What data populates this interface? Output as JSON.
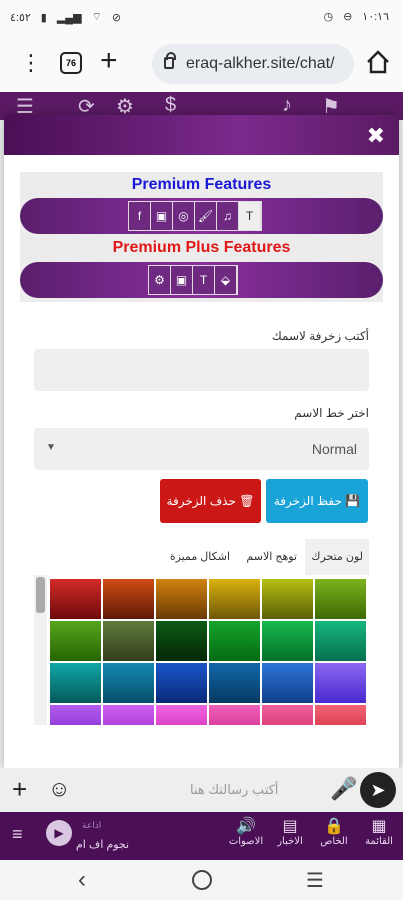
{
  "status_bar": {
    "left_time": "٤:٥٢",
    "right_time": "١٠:١٦"
  },
  "browser": {
    "url": "eraq-alkher.site/chat/",
    "tab_count": "76",
    "menu_glyph": "⋮",
    "plus_glyph": "+"
  },
  "modal": {
    "close_glyph": "✖",
    "premium_title": "Premium Features",
    "premium_plus_title": "Premium Plus Features",
    "premium_icons": [
      "T",
      "♫",
      "🖌",
      "◎",
      "▣",
      "f"
    ],
    "premium_plus_icons": [
      "⬙",
      "T",
      "▣",
      "⚙"
    ],
    "name_label": "أكتب زخرفة لاسمك",
    "font_label": "اختر خط الاسم",
    "font_value": "Normal",
    "save_button": "حفظ الزخرفة",
    "delete_button": "حذف الزخرفة",
    "tabs": [
      "لون متحرك",
      "توهج الاسم",
      "اشكال مميزة"
    ],
    "colors": [
      "#d42a2a",
      "#d04d15",
      "#d2830f",
      "#d9b20f",
      "#b5bf12",
      "#7db31d",
      "#57a51b",
      "#5f7a3a",
      "#0c5a16",
      "#16a52d",
      "#16b94c",
      "#16b67d",
      "#11a6a6",
      "#1689b2",
      "#1a56c8",
      "#1267a9",
      "#2e75d9",
      "#8a67f0",
      "#b35df0",
      "#cd62ef",
      "#ef65e0",
      "#ef60bb",
      "#f0639b",
      "#f26575"
    ],
    "colors_dark": [
      "#6e0a0a",
      "#5e1a06",
      "#6a3a05",
      "#6e5605",
      "#5a5f05",
      "#3d6a05",
      "#286505",
      "#343f1e",
      "#052805",
      "#056a12",
      "#05702a",
      "#057050",
      "#055a5a",
      "#054f6a",
      "#0a2a7a",
      "#063a62",
      "#0f3e8a",
      "#4a2ad0",
      "#7a20c8",
      "#9a20c8",
      "#c820b0",
      "#c8207e",
      "#c8205a",
      "#c82036"
    ]
  },
  "composer": {
    "placeholder": "أكتب رسالتك هنا"
  },
  "bottom_nav": {
    "items": [
      "القائمة",
      "الخاص",
      "الاخبار",
      "الاصوات"
    ],
    "player_title": "نجوم اف ام",
    "player_sub": "اذاعة"
  }
}
